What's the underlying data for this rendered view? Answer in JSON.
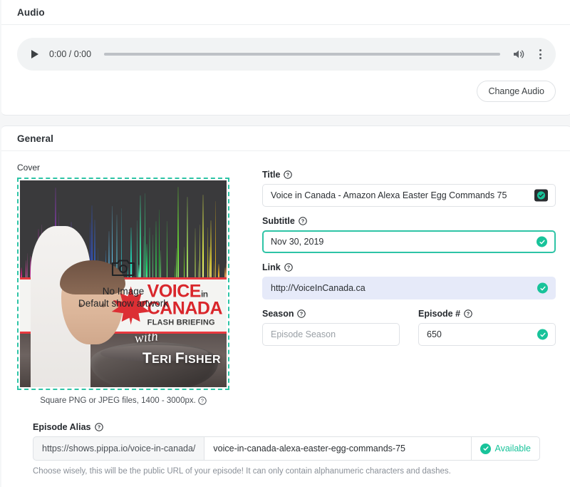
{
  "audio_section": {
    "title": "Audio",
    "player": {
      "time_display": "0:00 / 0:00",
      "play_icon": "play-icon",
      "volume_icon": "volume-icon",
      "more_icon": "kebab-menu-icon",
      "progress_percent": 0
    },
    "change_audio_label": "Change Audio"
  },
  "general_section": {
    "title": "General",
    "cover": {
      "label": "Cover",
      "overlay_line1": "No Image",
      "overlay_line2": "Default show artwork",
      "camera_icon": "camera-icon",
      "caption": "Square PNG or JPEG files, 1400 - 3000px.",
      "artwork": {
        "logo_line1": "VOICE",
        "logo_line1_suffix": "in",
        "logo_line2": "CANADA",
        "logo_line3": "FLASH BRIEFING",
        "host_prefix": "with",
        "host_name_first": "T",
        "host_name": "ERI ",
        "host_name_second": "F",
        "host_name_rest": "ISHER"
      }
    },
    "fields": {
      "title": {
        "label": "Title",
        "value": "Voice in Canada - Amazon Alexa Easter Egg Commands 75",
        "adorn_icon": "image-thumbnail-icon"
      },
      "subtitle": {
        "label": "Subtitle",
        "value": "Nov 30, 2019",
        "adorn_icon": "valid-check-icon",
        "focused": true
      },
      "link": {
        "label": "Link",
        "value": "http://VoiceInCanada.ca",
        "adorn_icon": "valid-check-icon",
        "autofilled": true
      },
      "season": {
        "label": "Season",
        "value": "",
        "placeholder": "Episode Season"
      },
      "episode_number": {
        "label": "Episode #",
        "value": "650",
        "adorn_icon": "valid-check-icon"
      }
    }
  },
  "episode_alias": {
    "label": "Episode Alias",
    "prefix": "https://shows.pippa.io/voice-in-canada/",
    "value": "voice-in-canada-alexa-easter-egg-commands-75",
    "status_label": "Available",
    "status_icon": "valid-check-icon",
    "hint": "Choose wisely, this will be the public URL of your episode! It can only contain alphanumeric characters and dashes."
  },
  "colors": {
    "accent_teal": "#2ec4a6",
    "valid_green": "#18c39a",
    "autofill_blue": "#e6eaf9",
    "page_bg": "#f5f6f7",
    "brand_red": "#d9262b"
  }
}
